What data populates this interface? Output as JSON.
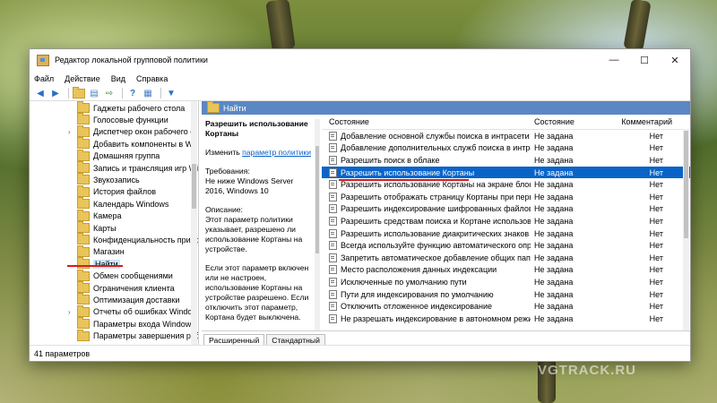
{
  "window": {
    "title": "Редактор локальной групповой политики",
    "minimize": "—",
    "maximize": "☐",
    "close": "✕"
  },
  "menu": [
    "Файл",
    "Действие",
    "Вид",
    "Справка"
  ],
  "tree": {
    "items": [
      {
        "label": "Гаджеты рабочего стола",
        "expandable": false
      },
      {
        "label": "Голосовые функции",
        "expandable": false
      },
      {
        "label": "Диспетчер окон рабочего с",
        "expandable": true
      },
      {
        "label": "Добавить компоненты в Wi",
        "expandable": false
      },
      {
        "label": "Домашняя группа",
        "expandable": false
      },
      {
        "label": "Запись и трансляция игр Wi",
        "expandable": false
      },
      {
        "label": "Звукозапись",
        "expandable": false
      },
      {
        "label": "История файлов",
        "expandable": false
      },
      {
        "label": "Календарь Windows",
        "expandable": false
      },
      {
        "label": "Камера",
        "expandable": false
      },
      {
        "label": "Карты",
        "expandable": false
      },
      {
        "label": "Конфиденциальность прило",
        "expandable": false
      },
      {
        "label": "Магазин",
        "expandable": false
      },
      {
        "label": "Найти",
        "expandable": false,
        "selected": true
      },
      {
        "label": "Обмен сообщениями",
        "expandable": false
      },
      {
        "label": "Ограничения клиента",
        "expandable": false
      },
      {
        "label": "Оптимизация доставки",
        "expandable": false
      },
      {
        "label": "Отчеты об ошибках Windov",
        "expandable": true
      },
      {
        "label": "Параметры входа Windows",
        "expandable": false
      },
      {
        "label": "Параметры завершения раб",
        "expandable": false
      }
    ]
  },
  "detail": {
    "header": "Найти",
    "description": {
      "heading": "Разрешить использование Кортаны",
      "edit_prefix": "Изменить",
      "edit_link": "параметр политики",
      "requirements": "Требования:\nНе ниже Windows Server 2016, Windows 10",
      "description": "Описание:\nЭтот параметр политики указывает, разрешено ли использование Кортаны на устройстве.",
      "more": "Если этот параметр включен или не настроен, использование Кортаны на устройстве разрешено. Если отключить этот параметр, Кортана будет выключена."
    },
    "columns": {
      "name": "Состояние",
      "state": "Состояние",
      "comment": "Комментарий"
    },
    "rows": [
      {
        "name": "Добавление основной службы поиска в интрасети",
        "state": "Не задана",
        "comment": "Нет"
      },
      {
        "name": "Добавление дополнительных служб поиска в интрасе",
        "state": "Не задана",
        "comment": "Нет"
      },
      {
        "name": "Разрешить поиск в облаке",
        "state": "Не задана",
        "comment": "Нет"
      },
      {
        "name": "Разрешить использование Кортаны",
        "state": "Не задана",
        "comment": "Нет",
        "selected": true
      },
      {
        "name": "Разрешить использование Кортаны на экране блок...",
        "state": "Не задана",
        "comment": "Нет"
      },
      {
        "name": "Разрешить отображать страницу Кортаны при перв...",
        "state": "Не задана",
        "comment": "Нет"
      },
      {
        "name": "Разрешить индексирование шифрованных файлов",
        "state": "Не задана",
        "comment": "Нет"
      },
      {
        "name": "Разрешить средствам поиска и Кортане использова...",
        "state": "Не задана",
        "comment": "Нет"
      },
      {
        "name": "Разрешить использование диакритических знаков",
        "state": "Не задана",
        "comment": "Нет"
      },
      {
        "name": "Всегда используйте функцию автоматического опре...",
        "state": "Не задана",
        "comment": "Нет"
      },
      {
        "name": "Запретить автоматическое добавление общих папо...",
        "state": "Не задана",
        "comment": "Нет"
      },
      {
        "name": "Место расположения данных индексации",
        "state": "Не задана",
        "comment": "Нет"
      },
      {
        "name": "Исключенные по умолчанию пути",
        "state": "Не задана",
        "comment": "Нет"
      },
      {
        "name": "Пути для индексирования по умолчанию",
        "state": "Не задана",
        "comment": "Нет"
      },
      {
        "name": "Отключить отложенное индексирование",
        "state": "Не задана",
        "comment": "Нет"
      },
      {
        "name": "Не разрешать индексирование в автономном режиме",
        "state": "Не задана",
        "comment": "Нет"
      }
    ],
    "tabs": [
      "Расширенный",
      "Стандартный"
    ]
  },
  "status": "41 параметров",
  "watermark": "VGTRACK.RU",
  "colors": {
    "selection": "#0a64c8",
    "header": "#5b87c3",
    "annotation": "#d21e1e"
  }
}
